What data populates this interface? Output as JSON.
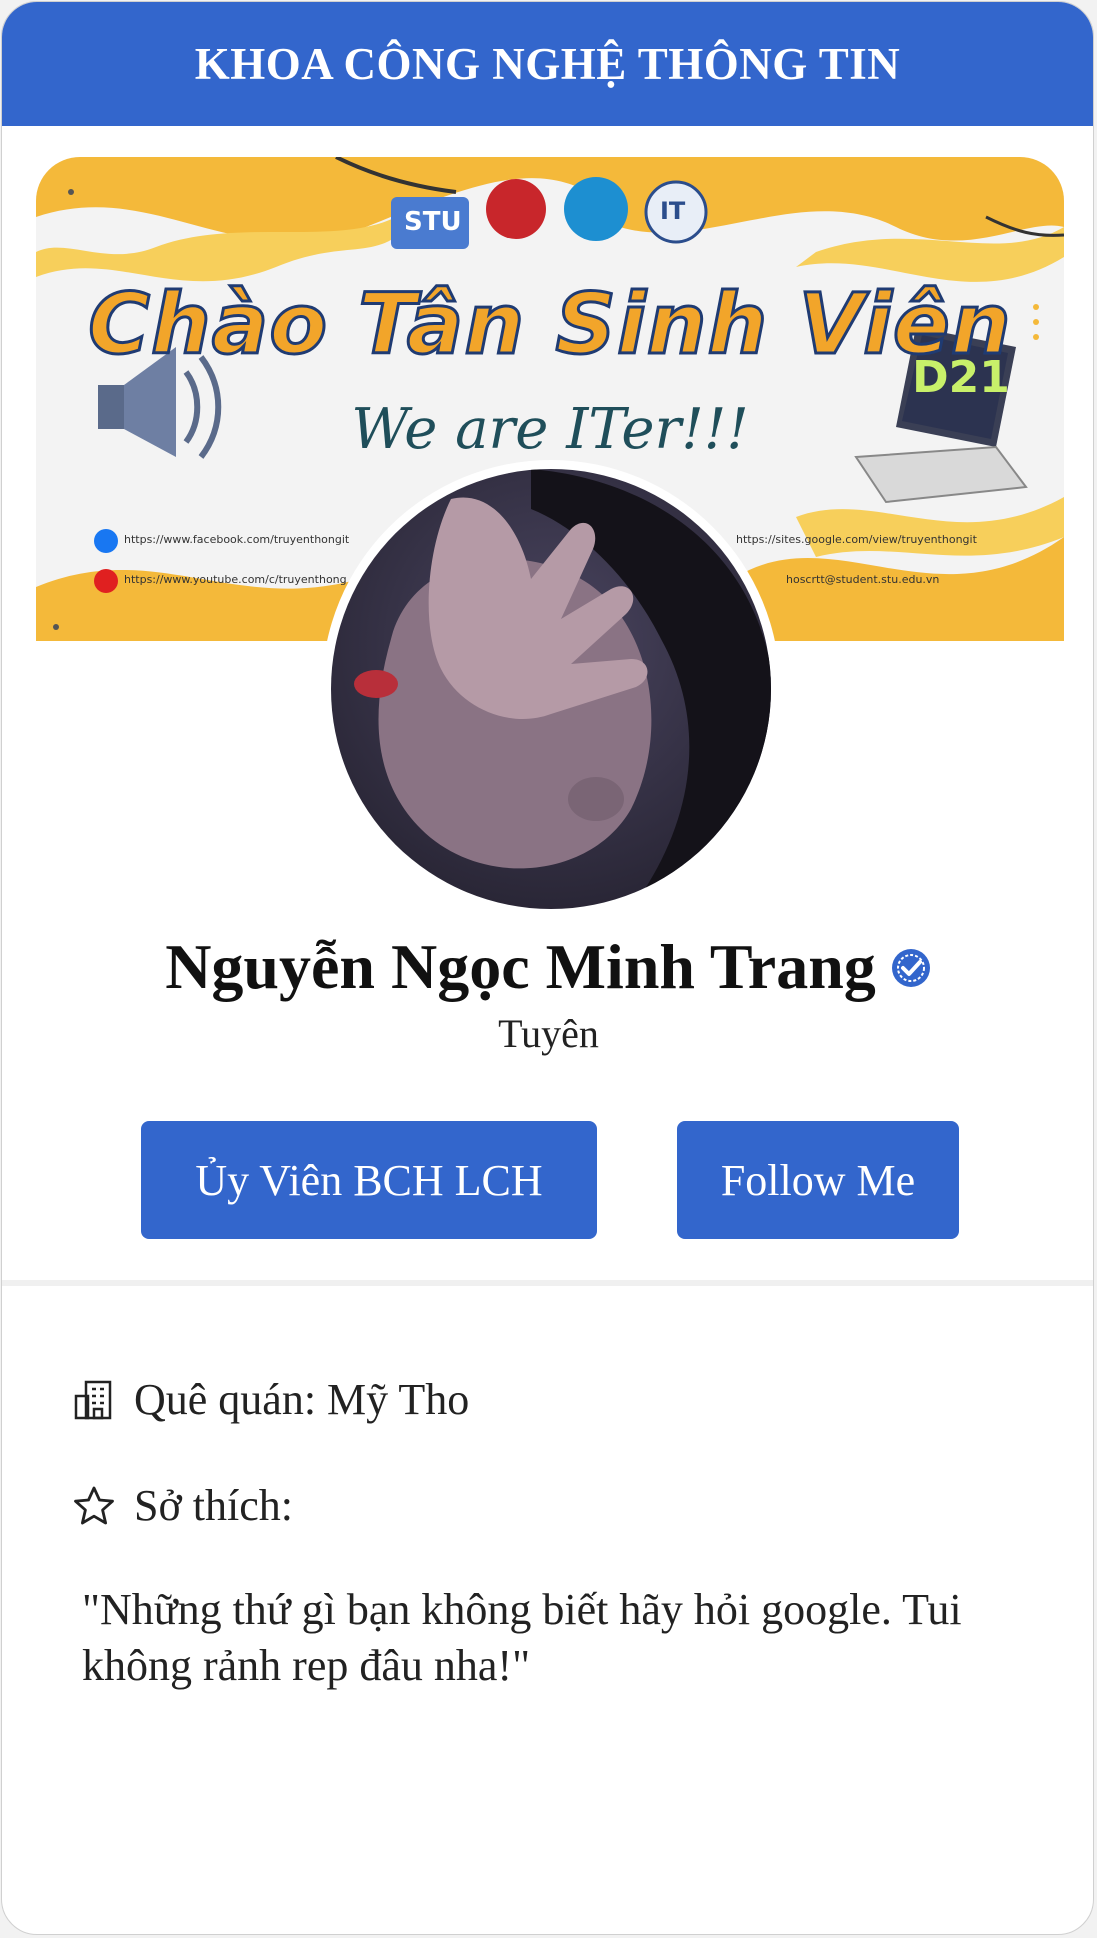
{
  "header": {
    "title": "KHOA CÔNG NGHỆ THÔNG TIN"
  },
  "cover": {
    "banner_title": "Chào Tân Sinh Viên",
    "banner_subtitle": "We are ITer!!!",
    "badge": "D21",
    "logos": [
      "STU",
      "IT"
    ],
    "links": [
      "https://www.facebook.com/truyenthongit",
      "https://www.youtube.com/c/truyenthong",
      "https://sites.google.com/view/truyenthongit",
      "hoscrtt@student.stu.edu.vn"
    ]
  },
  "profile": {
    "name": "Nguyễn Ngọc Minh Trang",
    "subtitle": "Tuyên",
    "verified_icon": "verified-check-icon"
  },
  "actions": {
    "role_label": "Ủy Viên BCH LCH",
    "follow_label": "Follow Me"
  },
  "details": {
    "hometown": "Quê quán: Mỹ Tho",
    "hobby": "Sở thích:",
    "quote": "\"Những thứ gì bạn không biết hãy hỏi google. Tui không rảnh rep đâu nha!\""
  },
  "colors": {
    "accent": "#3366cc",
    "banner_yellow": "#f4b93a"
  }
}
